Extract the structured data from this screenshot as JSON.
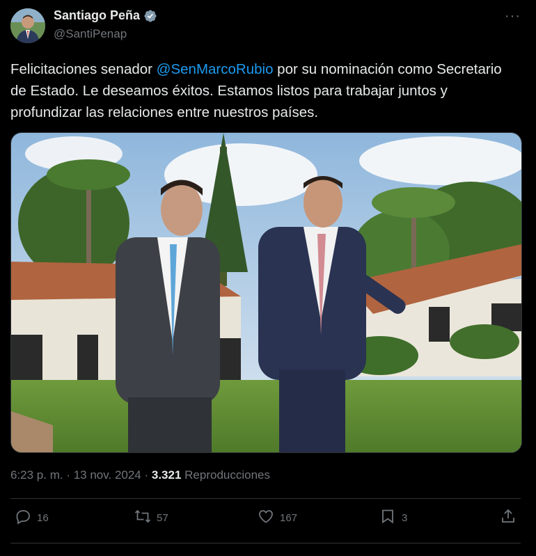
{
  "author": {
    "display_name": "Santiago Peña",
    "handle": "@SantiPenap"
  },
  "menu": {
    "more_label": "···"
  },
  "tweet": {
    "text_before": "Felicitaciones senador ",
    "mention": "@SenMarcoRubio",
    "text_after": " por su nominación como Secretario de Estado. Le deseamos éxitos. Estamos listos para trabajar juntos y profundizar las relaciones entre nuestros países."
  },
  "meta": {
    "time": "6:23 p. m.",
    "sep1": " · ",
    "date": "13 nov. 2024",
    "sep2": " · ",
    "views_count": "3.321",
    "views_label": " Reproducciones"
  },
  "actions": {
    "replies": "16",
    "reposts": "57",
    "likes": "167",
    "bookmarks": "3"
  },
  "icons": [
    "verified-icon",
    "more-icon",
    "reply-icon",
    "repost-icon",
    "like-icon",
    "bookmark-icon",
    "share-icon"
  ],
  "colors": {
    "accent": "#1d9bf0",
    "text": "#e7e9ea",
    "muted": "#71767b",
    "divider": "#2f3336",
    "background": "#000000"
  }
}
